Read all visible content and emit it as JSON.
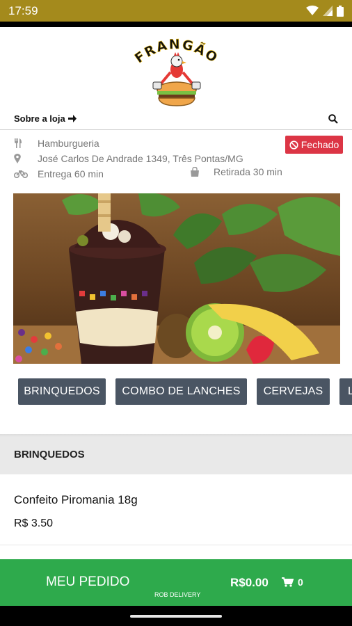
{
  "status_bar": {
    "time": "17:59",
    "icons": [
      "wifi-icon",
      "signal-icon",
      "battery-icon"
    ]
  },
  "logo": {
    "text": "FRANGÃO",
    "graphic": "chicken-burger-logo"
  },
  "store_bar": {
    "about_label": "Sobre a loja",
    "about_icon": "arrow-right-icon",
    "search_icon": "search-icon"
  },
  "store_info": {
    "category": "Hamburgueria",
    "address": "José Carlos De Andrade 1349, Três Pontas/MG",
    "delivery": "Entrega 60 min",
    "pickup": "Retirada 30 min",
    "status": "Fechado",
    "status_color": "#dc3545"
  },
  "banner": {
    "subject": "acai-dessert-cup-with-fruits"
  },
  "categories": [
    "BRINQUEDOS",
    "COMBO DE LANCHES",
    "CERVEJAS",
    "L"
  ],
  "section": {
    "title": "BRINQUEDOS"
  },
  "products": [
    {
      "name": "Confeito Piromania 18g",
      "price": "R$ 3.50"
    }
  ],
  "order_bar": {
    "label": "MEU PEDIDO",
    "total": "R$0.00",
    "cart_count": "0",
    "brand": "ROB DELIVERY",
    "color": "#2eaa4c"
  },
  "colors": {
    "status_bar": "#a48a1c",
    "category_button": "#4a5563"
  }
}
